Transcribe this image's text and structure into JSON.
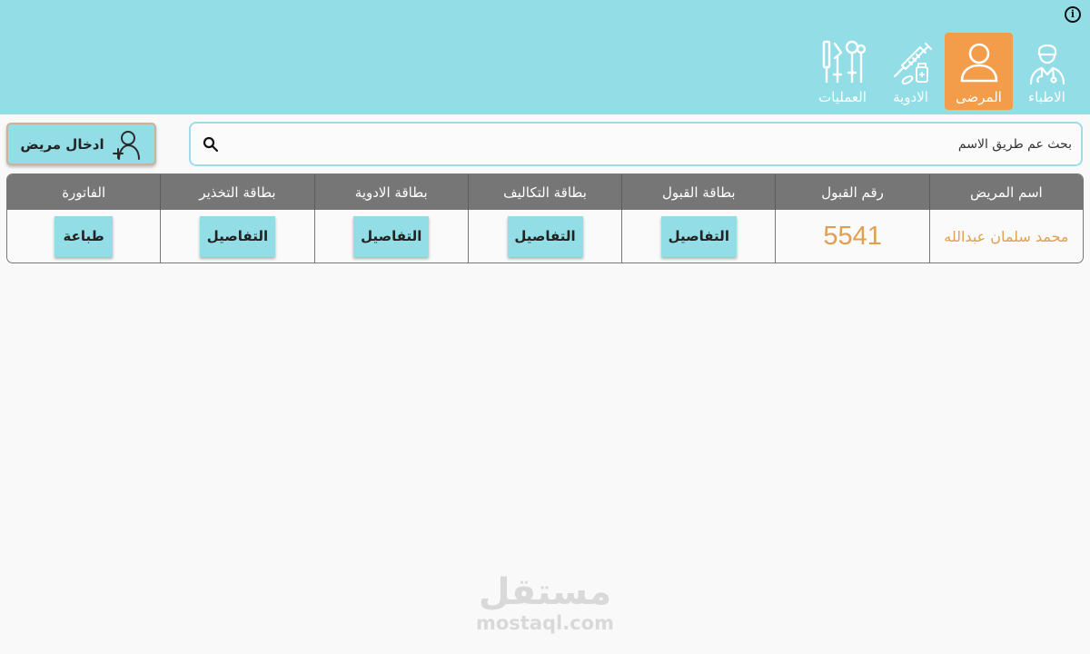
{
  "header": {
    "info_icon": "info-icon",
    "nav": [
      {
        "id": "doctors",
        "label": "الاطباء",
        "icon": "doctor-icon",
        "active": false
      },
      {
        "id": "patients",
        "label": "المرضى",
        "icon": "user-icon",
        "active": true
      },
      {
        "id": "medicines",
        "label": "الادوية",
        "icon": "syringe-medicine-icon",
        "active": false
      },
      {
        "id": "operations",
        "label": "العمليات",
        "icon": "surgical-tools-icon",
        "active": false
      }
    ]
  },
  "toolbar": {
    "search_placeholder": "بحث عم طريق الاسم",
    "search_icon": "search-icon",
    "add_patient_label": "ادخال مريض",
    "add_patient_icon": "add-user-icon"
  },
  "table": {
    "headers": [
      "اسم المريض",
      "رقم القبول",
      "بطاقة القبول",
      "بطاقة التكاليف",
      "بطاقة الادوية",
      "بطاقة التخذير",
      "الفاتورة"
    ],
    "rows": [
      {
        "patient_name": "محمد سلمان عبدالله",
        "admission_no": "5541",
        "admission_card": "التفاصيل",
        "costs_card": "التفاصيل",
        "medicines_card": "التفاصيل",
        "anesthesia_card": "التفاصيل",
        "invoice": "طباعة"
      }
    ]
  },
  "watermark": {
    "arabic": "مستقل",
    "latin": "mostaql.com"
  },
  "colors": {
    "header_bg": "#93dde6",
    "active_nav": "#f39c4a",
    "table_header": "#767676",
    "accent_text": "#e0a050"
  }
}
